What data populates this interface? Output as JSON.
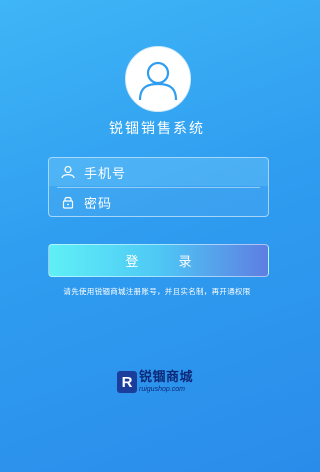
{
  "app": {
    "title": "锐锢销售系统"
  },
  "form": {
    "phone_placeholder": "手机号",
    "password_placeholder": "密码"
  },
  "login": {
    "label": "登 录"
  },
  "hint": "请先使用锐锢商城注册账号，并且实名制，再开通权限",
  "brand": {
    "mark": "R",
    "name_cn": "锐锢商城",
    "domain": "ruigushop.com"
  },
  "colors": {
    "bg": "#2f9df0",
    "button_start": "#5ff0f6",
    "button_end": "#5e7ee2",
    "brand": "#0d2a7a"
  }
}
